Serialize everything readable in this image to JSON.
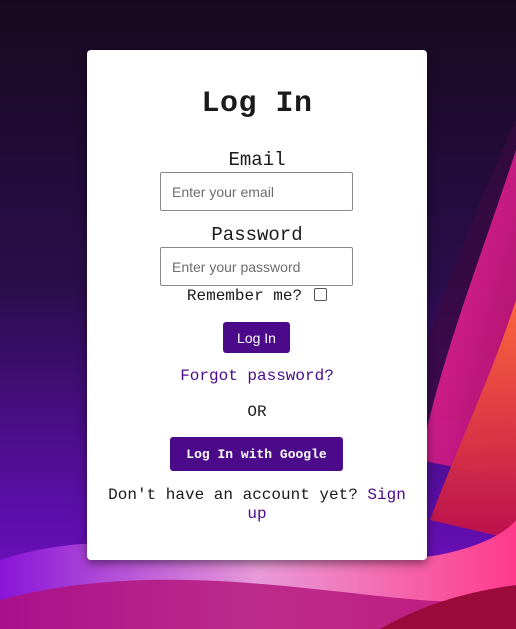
{
  "login_form": {
    "title": "Log In",
    "email_label": "Email",
    "email_placeholder": "Enter your email",
    "password_label": "Password",
    "password_placeholder": "Enter your password",
    "remember_label": "Remember me?",
    "remember_checked": false,
    "login_button": "Log In",
    "forgot_link": "Forgot password?",
    "or_text": "OR",
    "google_button": "Log In with Google",
    "signup_prompt": "Don't have an account yet?",
    "signup_link": "Sign up"
  },
  "colors": {
    "accent": "#4b0a8a",
    "card_background": "#ffffff"
  }
}
